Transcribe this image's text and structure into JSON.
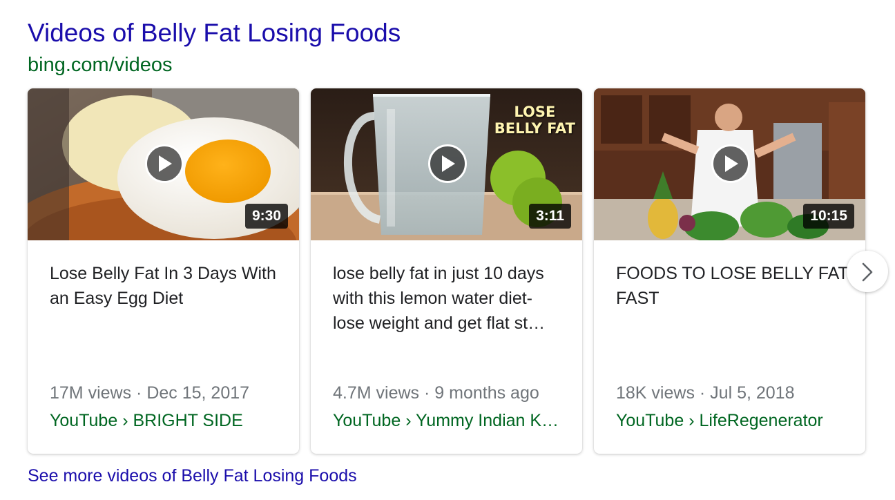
{
  "header": {
    "title": "Videos of Belly Fat Losing Foods",
    "source": "bing.com/videos"
  },
  "videos": [
    {
      "title": "Lose Belly Fat In 3 Days With an Easy Egg Diet",
      "duration": "9:30",
      "views": "17M views",
      "date": "Dec 15, 2017",
      "platform": "YouTube",
      "channel": "BRIGHT SIDE",
      "thumbnail_icon": "boiled-egg-thumbnail"
    },
    {
      "title": "lose belly fat in just 10 days with this lemon water diet- lose weight and get flat st…",
      "duration": "3:11",
      "views": "4.7M views",
      "date": "9 months ago",
      "platform": "YouTube",
      "channel": "Yummy Indian K…",
      "thumbnail_text": [
        "LOSE",
        "BELLY FAT"
      ],
      "thumbnail_icon": "lemon-water-thumbnail"
    },
    {
      "title": "FOODS TO LOSE BELLY FAT FAST",
      "duration": "10:15",
      "views": "18K views",
      "date": "Jul 5, 2018",
      "platform": "YouTube",
      "channel": "LifeRegenerator",
      "thumbnail_icon": "kitchen-vegetables-thumbnail"
    }
  ],
  "separator": " · ",
  "breadcrumb_sep": " › ",
  "see_more": "See more videos of Belly Fat Losing Foods",
  "colors": {
    "link": "#1a0dab",
    "source_green": "#006621",
    "meta_gray": "#70757a",
    "text": "#202124"
  },
  "icons": {
    "play": "play-icon",
    "next": "chevron-right-icon"
  }
}
